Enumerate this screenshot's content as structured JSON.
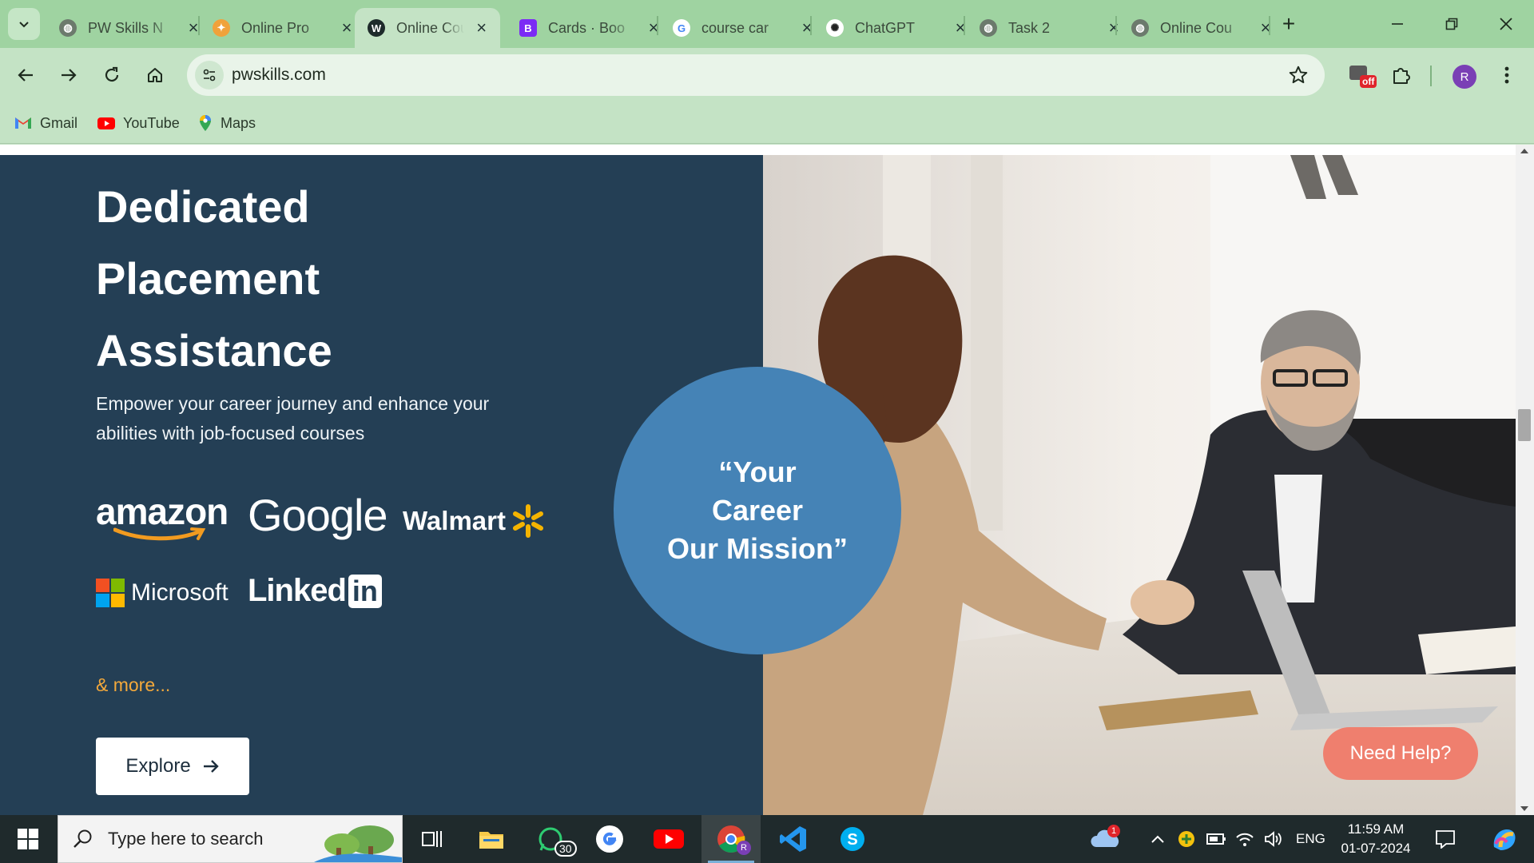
{
  "browser": {
    "tabs": [
      {
        "title": "PW Skills N",
        "favicon": "globe-icon",
        "active": false
      },
      {
        "title": "Online Pro",
        "favicon": "pw-logo-icon",
        "active": false
      },
      {
        "title": "Online Cou",
        "favicon": "wordpress-icon",
        "active": true
      },
      {
        "title": "Cards · Boo",
        "favicon": "bootstrap-icon",
        "active": false
      },
      {
        "title": "course car",
        "favicon": "google-icon",
        "active": false
      },
      {
        "title": "ChatGPT",
        "favicon": "chatgpt-icon",
        "active": false
      },
      {
        "title": "Task 2",
        "favicon": "globe-icon",
        "active": false
      },
      {
        "title": "Online Cou",
        "favicon": "globe-icon",
        "active": false
      }
    ],
    "new_tab": "+",
    "url": "pwskills.com",
    "extension_badge": "off",
    "profile_initial": "R",
    "bookmarks": [
      {
        "label": "Gmail",
        "icon": "gmail-icon"
      },
      {
        "label": "YouTube",
        "icon": "youtube-icon"
      },
      {
        "label": "Maps",
        "icon": "maps-icon"
      }
    ]
  },
  "hero": {
    "headline": [
      "Dedicated",
      "Placement",
      "Assistance"
    ],
    "subtext": "Empower your career journey and enhance your abilities with job-focused courses",
    "companies": [
      "amazon",
      "Google",
      "Walmart",
      "Microsoft",
      "Linked",
      "in"
    ],
    "more": "& more...",
    "cta": "Explore",
    "quote": [
      "“Your",
      "Career",
      "Our Mission”"
    ],
    "help_button": "Need Help?"
  },
  "taskbar": {
    "search_placeholder": "Type here to search",
    "whatsapp_badge": "30",
    "chrome_badge": "R",
    "cloud_badge": "1",
    "language": "ENG",
    "time": "11:59 AM",
    "date": "01-07-2024"
  },
  "colors": {
    "tabstrip": "#9fd3a1",
    "toolbar": "#c4e3c5",
    "panel": "#243f55",
    "circle": "#4583b6",
    "help": "#ef7f6e",
    "more": "#f4a93b"
  }
}
